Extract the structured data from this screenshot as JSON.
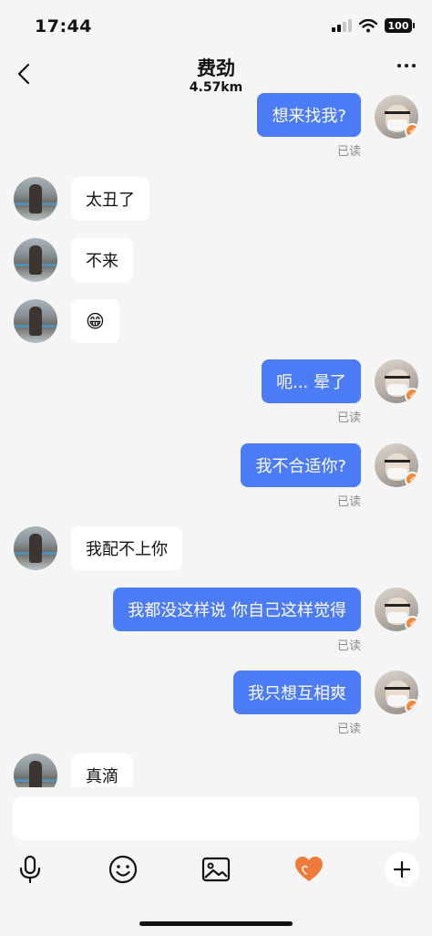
{
  "status_bar": {
    "time": "17:44",
    "battery": "100"
  },
  "header": {
    "title": "费劲",
    "distance": "4.57km"
  },
  "messages": [
    {
      "from": "self",
      "text": "想来找我?",
      "read": "已读"
    },
    {
      "from": "other",
      "text": "太丑了"
    },
    {
      "from": "other",
      "text": "不来"
    },
    {
      "from": "other",
      "text": "😁"
    },
    {
      "from": "self",
      "text": "呃... 晕了",
      "read": "已读"
    },
    {
      "from": "self",
      "text": "我不合适你?",
      "read": "已读"
    },
    {
      "from": "other",
      "text": "我配不上你"
    },
    {
      "from": "self",
      "text": "我都没这样说 你自己这样觉得",
      "read": "已读"
    },
    {
      "from": "self",
      "text": "我只想互相爽",
      "read": "已读"
    },
    {
      "from": "other",
      "text": "真滴"
    }
  ],
  "toolbar": {
    "icons": [
      "microphone-icon",
      "emoji-icon",
      "image-icon",
      "heart-icon",
      "plus-icon"
    ],
    "accent": "#4b7bf5",
    "heart_color": "#f07a3a"
  }
}
